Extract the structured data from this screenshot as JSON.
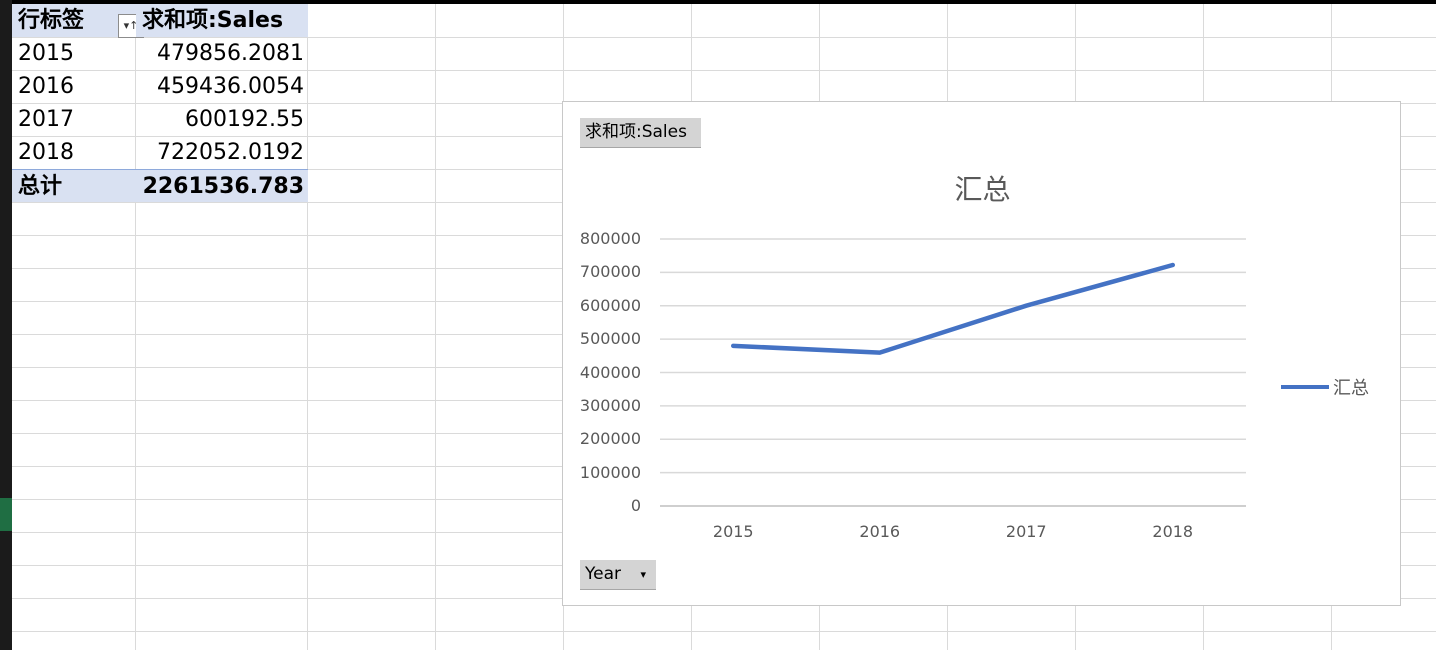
{
  "pivot": {
    "header": {
      "row_label": "行标签",
      "value_label": "求和项:Sales"
    },
    "rows": [
      {
        "year": "2015",
        "value": "479856.2081"
      },
      {
        "year": "2016",
        "value": "459436.0054"
      },
      {
        "year": "2017",
        "value": "600192.55"
      },
      {
        "year": "2018",
        "value": "722052.0192"
      }
    ],
    "total": {
      "label": "总计",
      "value": "2261536.783"
    },
    "filter_icon": "filter-sort-icon"
  },
  "chart": {
    "value_field_button": "求和项:Sales",
    "axis_field_button": "Year",
    "axis_field_dropdown_icon": "▾",
    "legend_label": "汇总",
    "y_tick_labels": [
      "800000",
      "700000",
      "600000",
      "500000",
      "400000",
      "300000",
      "200000",
      "100000",
      "0"
    ],
    "x_tick_labels": [
      "2015",
      "2016",
      "2017",
      "2018"
    ]
  },
  "chart_data": {
    "type": "line",
    "title": "汇总",
    "categories": [
      "2015",
      "2016",
      "2017",
      "2018"
    ],
    "series": [
      {
        "name": "汇总",
        "values": [
          479856.2081,
          459436.0054,
          600192.55,
          722052.0192
        ],
        "color": "#4472c4"
      }
    ],
    "ylim": [
      0,
      800000
    ],
    "grid": true,
    "legend": "right"
  }
}
